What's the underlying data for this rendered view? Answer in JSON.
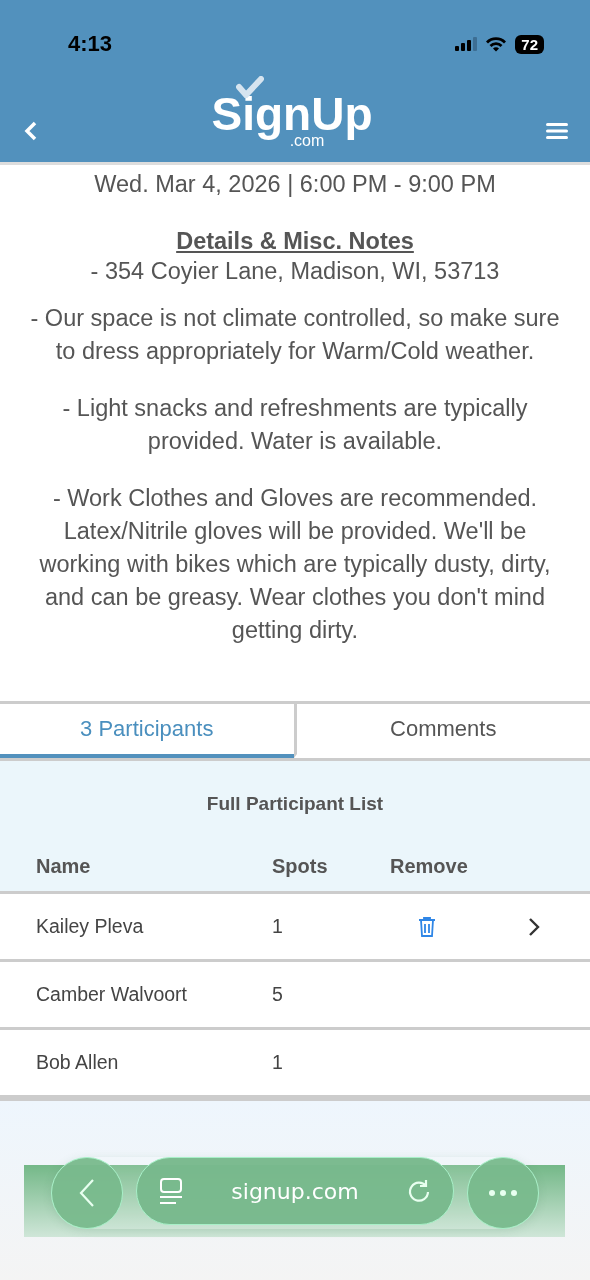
{
  "status_bar": {
    "time": "4:13",
    "battery": "72"
  },
  "header": {
    "logo": {
      "name": "SignUp",
      "suffix": ".com"
    }
  },
  "event": {
    "when": "Wed. Mar 4, 2026 | 6:00 PM - 9:00 PM",
    "notes_title": "Details & Misc. Notes",
    "address": "- 354 Coyier Lane, Madison, WI, 53713",
    "notes": [
      "- Our space is not climate controlled, so make sure to dress appropriately for Warm/Cold weather.",
      "- Light snacks and refreshments are typically provided. Water is available.",
      "- Work Clothes and Gloves are recommended. Latex/Nitrile gloves will be provided. We'll be working with bikes which are typically dusty, dirty, and can be greasy. Wear clothes you don't mind getting dirty."
    ]
  },
  "tabs": [
    {
      "label": "3 Participants",
      "selected": true
    },
    {
      "label": "Comments",
      "selected": false
    }
  ],
  "participants": {
    "title": "Full Participant List",
    "columns": [
      "Name",
      "Spots",
      "Remove"
    ],
    "rows": [
      {
        "name": "Kailey Pleva",
        "spots": "1",
        "removable": true,
        "expandable": true
      },
      {
        "name": "Camber Walvoort",
        "spots": "5",
        "removable": false,
        "expandable": false
      },
      {
        "name": "Bob Allen",
        "spots": "1",
        "removable": false,
        "expandable": false
      }
    ]
  },
  "browser_bar": {
    "url": "signup.com"
  }
}
